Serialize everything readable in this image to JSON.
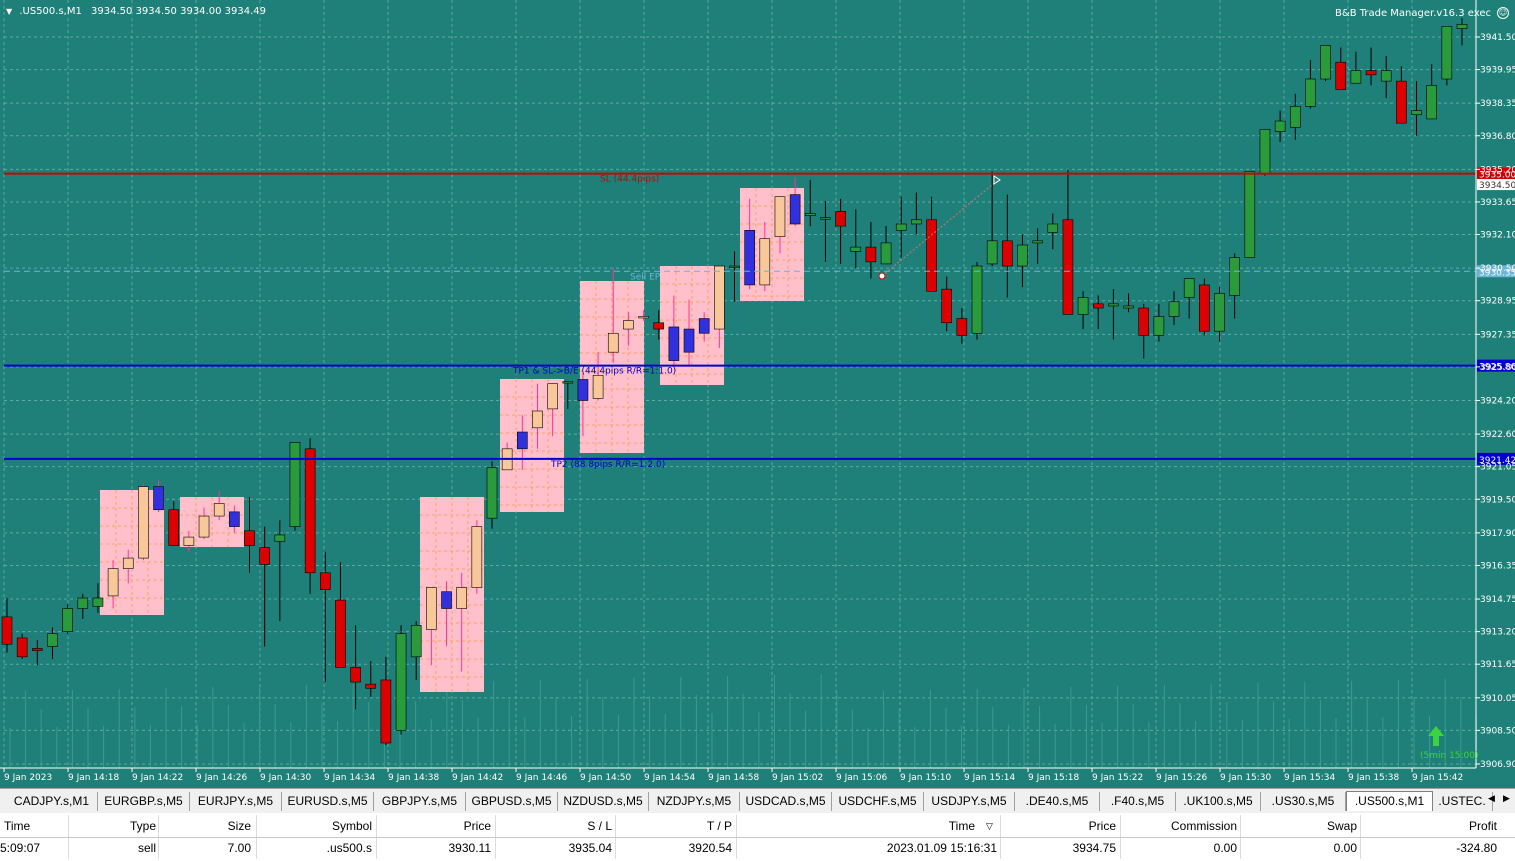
{
  "chart": {
    "symbol_info": ".US500.s,M1",
    "ohlc": "3934.50 3934.50 3934.00 3934.49",
    "ea_name": "B&B Trade Manager.v16.3 exec",
    "ea_icon": "smiley-icon",
    "price_labels": [
      "3941.50",
      "3939.95",
      "3938.35",
      "3936.80",
      "3935.20",
      "3933.65",
      "3932.10",
      "3930.50",
      "3928.95",
      "3927.35",
      "3925.80",
      "3924.20",
      "3922.60",
      "3921.05",
      "3919.50",
      "3917.90",
      "3916.35",
      "3914.75",
      "3913.20",
      "3911.65",
      "3910.05",
      "3908.50",
      "3906.90"
    ],
    "time_labels": [
      "9 Jan 2023",
      "9 Jan 14:18",
      "9 Jan 14:22",
      "9 Jan 14:26",
      "9 Jan 14:30",
      "9 Jan 14:34",
      "9 Jan 14:38",
      "9 Jan 14:42",
      "9 Jan 14:46",
      "9 Jan 14:50",
      "9 Jan 14:54",
      "9 Jan 14:58",
      "9 Jan 15:02",
      "9 Jan 15:06",
      "9 Jan 15:10",
      "9 Jan 15:14",
      "9 Jan 15:18",
      "9 Jan 15:22",
      "9 Jan 15:26",
      "9 Jan 15:30",
      "9 Jan 15:34",
      "9 Jan 15:38",
      "9 Jan 15:42"
    ],
    "sl_line": {
      "label": "SL (44.4pips)",
      "price_tag": "3935.00",
      "color": "#cc0000"
    },
    "tp1_line": {
      "label": "TP1 & SL->B/E (44.4pips R/R=1:1.0)",
      "price_tag": "3925.86",
      "color": "#0000cc"
    },
    "tp2_line": {
      "label": "TP2 (88.8pips R/R=1:2.0)",
      "price_tag": "3921.42",
      "color": "#0000cc"
    },
    "entry_line": {
      "label": "Sell EP",
      "price_tag": "3930.35",
      "color": "#6ab4d8"
    },
    "ask_tag": "3934.50",
    "signal_label": "(5min 15:00)",
    "signal_icon": "up-arrow-icon",
    "colors": {
      "background": "#1e8078",
      "bull": "#2a9b3c",
      "bear": "#dd0000",
      "box": "#ffc0cb"
    },
    "candles": [
      [
        3913.9,
        3914.8,
        3912.2,
        3912.6
      ],
      [
        3912.9,
        3913.1,
        3911.9,
        3912.0
      ],
      [
        3912.4,
        3912.8,
        3911.6,
        3912.3
      ],
      [
        3912.5,
        3913.4,
        3911.9,
        3913.1
      ],
      [
        3913.2,
        3914.5,
        3913.1,
        3914.3
      ],
      [
        3914.3,
        3915.0,
        3913.8,
        3914.8
      ],
      [
        3914.4,
        3915.5,
        3914.1,
        3914.8
      ],
      [
        3914.9,
        3916.6,
        3914.3,
        3916.2
      ],
      [
        3916.2,
        3917.1,
        3915.5,
        3916.7
      ],
      [
        3916.7,
        3920.2,
        3916.6,
        3920.1
      ],
      [
        3920.1,
        3920.4,
        3918.9,
        3919.0
      ],
      [
        3919.0,
        3919.4,
        3917.3,
        3917.3
      ],
      [
        3917.3,
        3918.0,
        3917.0,
        3917.7
      ],
      [
        3917.7,
        3919.1,
        3917.6,
        3918.7
      ],
      [
        3918.7,
        3919.9,
        3918.5,
        3919.3
      ],
      [
        3918.9,
        3919.2,
        3917.9,
        3918.2
      ],
      [
        3918.0,
        3919.6,
        3916.0,
        3917.3
      ],
      [
        3917.2,
        3918.2,
        3912.5,
        3916.4
      ],
      [
        3917.5,
        3918.5,
        3913.7,
        3917.8
      ],
      [
        3918.2,
        3921.0,
        3918.0,
        3922.2
      ],
      [
        3921.9,
        3922.4,
        3915.0,
        3916.0
      ],
      [
        3916.0,
        3917.0,
        3910.8,
        3915.2
      ],
      [
        3914.7,
        3916.5,
        3911.5,
        3911.5
      ],
      [
        3911.5,
        3913.5,
        3909.5,
        3910.8
      ],
      [
        3910.7,
        3911.8,
        3910.1,
        3910.5
      ],
      [
        3910.9,
        3912.0,
        3907.8,
        3907.9
      ],
      [
        3908.5,
        3913.5,
        3908.3,
        3913.1
      ],
      [
        3912.0,
        3913.7,
        3910.9,
        3913.5
      ],
      [
        3913.3,
        3915.3,
        3911.6,
        3915.3
      ],
      [
        3915.1,
        3915.6,
        3912.5,
        3914.3
      ],
      [
        3914.3,
        3916.0,
        3911.3,
        3915.3
      ],
      [
        3915.3,
        3918.5,
        3915.0,
        3918.2
      ],
      [
        3918.6,
        3921.3,
        3918.1,
        3921.0
      ],
      [
        3920.9,
        3922.2,
        3921.8,
        3921.9
      ],
      [
        3922.7,
        3923.5,
        3920.9,
        3921.9
      ],
      [
        3922.9,
        3925.0,
        3921.9,
        3923.7
      ],
      [
        3923.8,
        3925.0,
        3922.5,
        3925.0
      ],
      [
        3925.1,
        3925.1,
        3923.8,
        3925.1
      ],
      [
        3925.2,
        3925.5,
        3922.5,
        3924.2
      ],
      [
        3924.3,
        3926.5,
        3924.2,
        3925.4
      ],
      [
        3926.5,
        3930.5,
        3926.0,
        3927.4
      ],
      [
        3927.6,
        3928.4,
        3926.8,
        3928.0
      ],
      [
        3928.2,
        3928.5,
        3928.0,
        3928.2
      ],
      [
        3927.9,
        3928.5,
        3927.1,
        3927.6
      ],
      [
        3927.7,
        3929.2,
        3925.9,
        3926.1
      ],
      [
        3927.6,
        3929.0,
        3925.8,
        3926.5
      ],
      [
        3928.1,
        3928.4,
        3927.0,
        3927.4
      ],
      [
        3927.6,
        3929.5,
        3926.7,
        3930.6
      ],
      [
        3930.6,
        3931.3,
        3928.9,
        3930.6
      ],
      [
        3932.3,
        3933.8,
        3929.5,
        3929.7
      ],
      [
        3929.7,
        3932.7,
        3929.4,
        3931.9
      ],
      [
        3932.0,
        3933.9,
        3931.2,
        3933.9
      ],
      [
        3934.0,
        3934.8,
        3932.5,
        3932.6
      ],
      [
        3933.0,
        3934.7,
        3932.5,
        3933.1
      ],
      [
        3932.9,
        3933.7,
        3930.8,
        3932.9
      ],
      [
        3933.2,
        3933.8,
        3930.7,
        3932.5
      ],
      [
        3931.3,
        3933.3,
        3930.5,
        3931.5
      ],
      [
        3931.5,
        3932.7,
        3930.0,
        3930.8
      ],
      [
        3930.7,
        3932.5,
        3931.2,
        3931.7
      ],
      [
        3932.3,
        3933.9,
        3931.0,
        3932.6
      ],
      [
        3932.6,
        3934.1,
        3932.1,
        3932.8
      ],
      [
        3932.8,
        3933.9,
        3929.4,
        3929.4
      ],
      [
        3929.5,
        3930.1,
        3927.5,
        3927.9
      ],
      [
        3928.1,
        3928.6,
        3926.9,
        3927.3
      ],
      [
        3927.4,
        3930.8,
        3927.1,
        3930.6
      ],
      [
        3930.7,
        3935.1,
        3930.6,
        3931.8
      ],
      [
        3931.8,
        3934.0,
        3929.1,
        3930.6
      ],
      [
        3930.6,
        3932.1,
        3929.6,
        3931.6
      ],
      [
        3931.7,
        3932.4,
        3930.7,
        3931.8
      ],
      [
        3932.2,
        3933.1,
        3931.4,
        3932.6
      ],
      [
        3932.8,
        3935.2,
        3931.8,
        3928.3
      ],
      [
        3928.3,
        3929.4,
        3927.6,
        3929.1
      ],
      [
        3928.8,
        3929.2,
        3927.6,
        3928.6
      ],
      [
        3928.7,
        3929.5,
        3927.1,
        3928.8
      ],
      [
        3928.6,
        3929.3,
        3928.4,
        3928.7
      ],
      [
        3928.6,
        3928.8,
        3926.2,
        3927.3
      ],
      [
        3927.3,
        3928.8,
        3927.0,
        3928.2
      ],
      [
        3928.2,
        3929.4,
        3927.8,
        3928.9
      ],
      [
        3929.1,
        3929.6,
        3928.1,
        3930.0
      ],
      [
        3929.7,
        3930.0,
        3927.3,
        3927.5
      ],
      [
        3927.5,
        3929.6,
        3927.0,
        3929.3
      ],
      [
        3929.2,
        3931.2,
        3928.1,
        3931.0
      ],
      [
        3931.0,
        3935.0,
        3931.0,
        3935.1
      ],
      [
        3935.0,
        3937.1,
        3934.9,
        3937.1
      ],
      [
        3937.0,
        3938.0,
        3936.5,
        3937.5
      ],
      [
        3937.2,
        3938.8,
        3936.6,
        3938.2
      ],
      [
        3938.2,
        3940.4,
        3938.1,
        3939.5
      ],
      [
        3939.5,
        3940.8,
        3939.4,
        3941.1
      ],
      [
        3940.3,
        3941.0,
        3939.2,
        3939.0
      ],
      [
        3939.3,
        3940.8,
        3939.5,
        3939.9
      ],
      [
        3939.9,
        3941.0,
        3939.2,
        3939.7
      ],
      [
        3939.4,
        3940.6,
        3938.6,
        3939.9
      ],
      [
        3939.4,
        3940.1,
        3937.4,
        3937.4
      ],
      [
        3937.8,
        3939.4,
        3936.8,
        3938.0
      ],
      [
        3937.6,
        3940.2,
        3937.6,
        3939.2
      ],
      [
        3939.5,
        3941.7,
        3939.2,
        3942.0
      ],
      [
        3941.9,
        3942.4,
        3941.1,
        3942.1
      ]
    ]
  },
  "symbol_tabs": [
    ".CADJPY.s,M1",
    "EURGBP.s,M5",
    "EURJPY.s,M5",
    "EURUSD.s,M5",
    "GBPJPY.s,M5",
    "GBPUSD.s,M5",
    "NZDUSD.s,M5",
    "NZDJPY.s,M5",
    "USDCAD.s,M5",
    "USDCHF.s,M5",
    "USDJPY.s,M5",
    ".DE40.s,M5",
    ".F40.s,M5",
    ".UK100.s,M5",
    ".US30.s,M5",
    ".US500.s,M1",
    ".USTEC."
  ],
  "visible_tab_texts": [
    "CADJPY.s,M1",
    "EURGBP.s,M5",
    "EURJPY.s,M5",
    "EURUSD.s,M5",
    "GBPJPY.s,M5",
    "GBPUSD.s,M5",
    "NZDUSD.s,M5",
    "NZDJPY.s,M5",
    "USDCAD.s,M5",
    "USDCHF.s,M5",
    "USDJPY.s,M5",
    ".DE40.s,M5",
    ".F40.s,M5",
    ".UK100.s,M5",
    ".US30.s,M5",
    ".US500.s,M1",
    ".USTEC."
  ],
  "active_tab": ".US500.s,M1",
  "trade_table": {
    "headers": [
      "Time",
      "Type",
      "Size",
      "Symbol",
      "Price",
      "S / L",
      "T / P",
      "Time",
      "Price",
      "Commission",
      "Swap",
      "Profit"
    ],
    "sort_icon": "sort-down-icon",
    "row": [
      "5:09:07",
      "sell",
      "7.00",
      ".us500.s",
      "3930.11",
      "3935.04",
      "3920.54",
      "2023.01.09 15:16:31",
      "3934.75",
      "0.00",
      "0.00",
      "-324.80"
    ]
  }
}
